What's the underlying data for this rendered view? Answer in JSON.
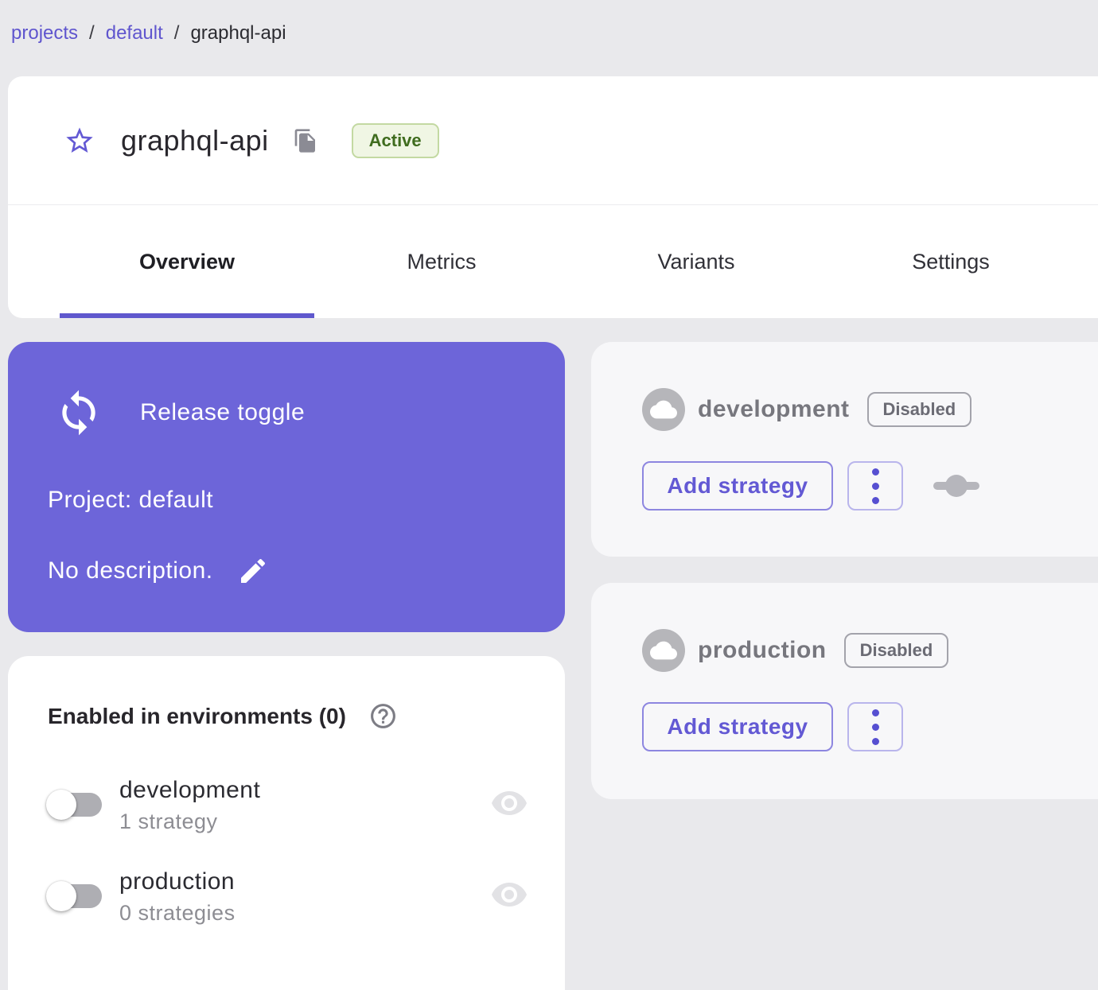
{
  "colors": {
    "page_bg": "#e9e9ec",
    "accent_purple": "#6359d4",
    "toggle_card_purple": "#6d65d9",
    "active_badge_bg": "#f0f6e4",
    "active_badge_border": "#c3d9a2",
    "active_badge_text": "#3f6c1e",
    "disabled_chip_text": "#6b6b74",
    "env_card_bg": "#f7f7f9",
    "muted_gray_text": "#8d8d93"
  },
  "breadcrumb": {
    "separator": "/",
    "items": [
      {
        "label": "projects"
      },
      {
        "label": "default"
      },
      {
        "label": "graphql-api"
      }
    ]
  },
  "header": {
    "title": "graphql-api",
    "status": "Active"
  },
  "tabs": [
    {
      "label": "Overview",
      "active": true
    },
    {
      "label": "Metrics",
      "active": false
    },
    {
      "label": "Variants",
      "active": false
    },
    {
      "label": "Settings",
      "active": false
    }
  ],
  "toggle_card": {
    "type_label": "Release toggle",
    "project": "Project: default",
    "description": "No description."
  },
  "environments": [
    {
      "name": "development",
      "status": "Disabled",
      "add_button": "Add strategy",
      "has_slider_icon": true
    },
    {
      "name": "production",
      "status": "Disabled",
      "add_button": "Add strategy",
      "has_slider_icon": false
    }
  ],
  "enabled_section": {
    "title": "Enabled in environments (0)",
    "rows": [
      {
        "name": "development",
        "strategies": "1 strategy",
        "enabled": false
      },
      {
        "name": "production",
        "strategies": "0 strategies",
        "enabled": false
      }
    ]
  },
  "icons": {
    "star": "star-outline",
    "copy": "content-copy",
    "loop": "loop-refresh-arrows",
    "edit": "pencil",
    "cloud": "cloud",
    "kebab": "three-dots-vertical",
    "slider": "slider-handle",
    "help": "question-mark-circle",
    "eye": "visibility"
  }
}
